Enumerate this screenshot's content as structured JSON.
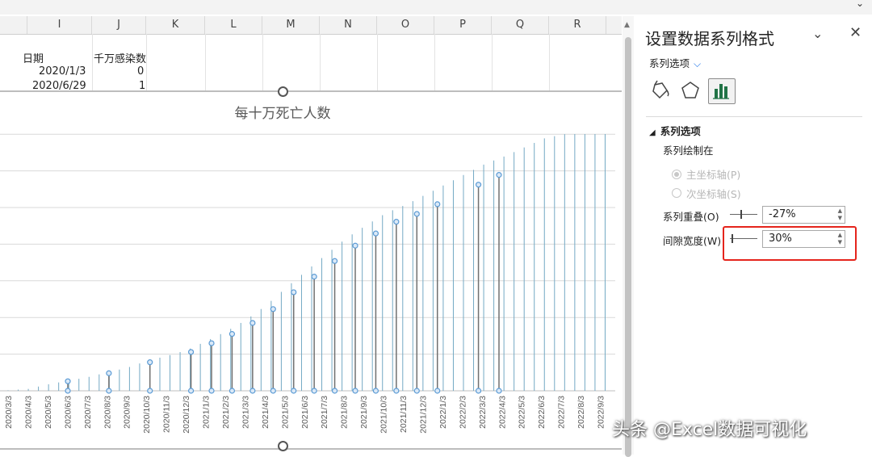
{
  "columns": [
    "I",
    "J",
    "K",
    "L",
    "M",
    "N",
    "O",
    "P",
    "Q",
    "R"
  ],
  "cells": {
    "date_header": "日期",
    "count_header": "千万感染数",
    "row1_date": "2020/1/3",
    "row1_count": "0",
    "row2_date": "2020/6/29",
    "row2_count": "1"
  },
  "chart_data": {
    "type": "bar",
    "title": "每十万死亡人数",
    "categories": [
      "2020/3/3",
      "2020/4/3",
      "2020/5/3",
      "2020/6/3",
      "2020/7/3",
      "2020/8/3",
      "2020/9/3",
      "2020/10/3",
      "2020/11/3",
      "2020/12/3",
      "2021/1/3",
      "2021/2/3",
      "2021/3/3",
      "2021/4/3",
      "2021/5/3",
      "2021/6/3",
      "2021/7/3",
      "2021/8/3",
      "2021/9/3",
      "2021/10/3",
      "2021/11/3",
      "2021/12/3",
      "2022/1/3",
      "2022/2/3",
      "2022/3/3",
      "2022/4/3",
      "2022/5/3",
      "2022/6/3",
      "2022/7/3",
      "2022/8/3",
      "2022/9/3"
    ],
    "values": [
      0.2,
      0.7,
      2.5,
      3.9,
      5.3,
      7.2,
      9.0,
      11.7,
      13.6,
      15.9,
      19.5,
      23.3,
      27.8,
      33.5,
      40.4,
      46.8,
      53.2,
      59.5,
      64.5,
      69.3,
      72.5,
      76.5,
      80.5,
      84.5,
      88.5,
      91.5,
      95.0,
      98.5,
      100,
      100,
      100
    ],
    "grid": true,
    "bar_color": "#74a9c4",
    "marker_color": "#5b9bd5",
    "stem_color": "#707070"
  },
  "pane": {
    "title": "设置数据系列格式",
    "collapse_icon": "chevron-down-icon",
    "close_icon": "close-icon",
    "series_options_dropdown": "系列选项",
    "tabs": [
      "fill-line-icon",
      "effects-icon",
      "series-options-icon"
    ],
    "section_title": "系列选项",
    "plot_on_label": "系列绘制在",
    "primary_axis": "主坐标轴(P)",
    "secondary_axis": "次坐标轴(S)",
    "overlap_label": "系列重叠(O)",
    "overlap_value": "-27%",
    "overlap_level": 0.37,
    "gap_label": "间隙宽度(W)",
    "gap_value": "30%",
    "gap_level": 0.06
  },
  "watermark": "头条 @Excel数据可视化",
  "highlight_color": "#e5241c"
}
